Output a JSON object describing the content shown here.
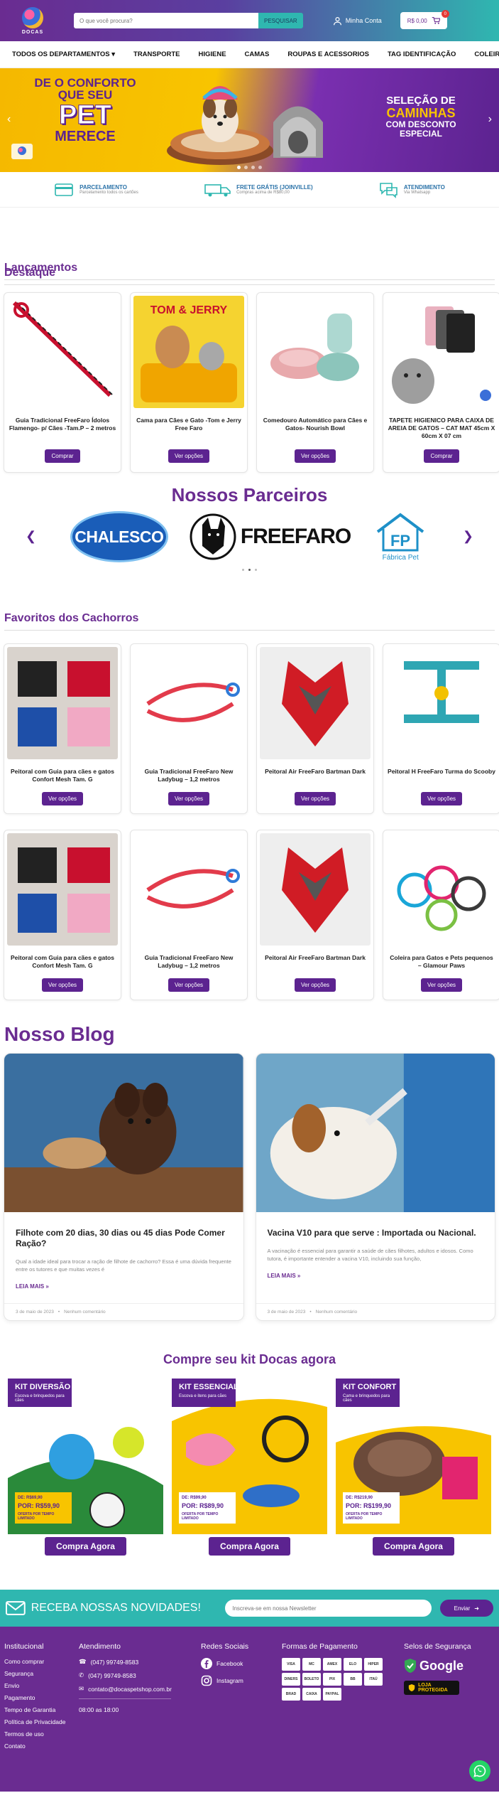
{
  "header": {
    "logo_text": "DOCAS",
    "search_placeholder": "O que você procura?",
    "search_button": "PESQUISAR",
    "account_label": "Minha Conta",
    "cart_total": "R$ 0,00",
    "cart_count": "0"
  },
  "nav": {
    "items": [
      "TODOS OS DEPARTAMENTOS",
      "TRANSPORTE",
      "HIGIENE",
      "CAMAS",
      "ROUPAS E ACESSORIOS",
      "TAG IDENTIFICAÇÃO",
      "COLEIRAS"
    ]
  },
  "hero": {
    "left_line1": "DE O CONFORTO",
    "left_line2": "QUE SEU",
    "left_line3": "PET",
    "left_line4": "MERECE",
    "right_line1": "SELEÇÃO DE",
    "right_line2": "CAMINHAS",
    "right_line3": "COM DESCONTO",
    "right_line4": "ESPECIAL",
    "prev_icon": "‹",
    "next_icon": "›"
  },
  "benefits": [
    {
      "title": "PARCELAMENTO",
      "subtitle": "Parcelamento todos os cartões",
      "icon": "credit-card-icon"
    },
    {
      "title": "FRETE GRÁTIS (JOINVILLE)",
      "subtitle": "Compras acima de R$80,00",
      "icon": "truck-icon"
    },
    {
      "title": "ATENDIMENTO",
      "subtitle": "Via Whatsapp",
      "icon": "chat-icon"
    }
  ],
  "sections": {
    "launches": "Lançamentos",
    "featured": "Destaque",
    "partners": "Nossos Parceiros",
    "dog_favorites": "Favoritos dos Cachorros",
    "blog": "Nosso Blog",
    "kits": "Compre seu kit Docas agora"
  },
  "featured_products": [
    {
      "name": "Guia Tradicional FreeFaro Ídolos Flamengo- p/ Cães -Tam.P – 2 metros",
      "button": "Comprar"
    },
    {
      "name": "Cama para Cães e Gato -Tom e Jerry Free Faro",
      "button": "Ver opções"
    },
    {
      "name": "Comedouro Automático para Cães e Gatos- Nourish Bowl",
      "button": "Ver opções"
    },
    {
      "name": "TAPETE HIGIENICO PARA CAIXA DE AREIA DE GATOS – CAT MAT 45cm X 60cm X 07 cm",
      "button": "Comprar"
    }
  ],
  "featured_extra": {
    "tom_jerry": "TOM & JERRY"
  },
  "partners": {
    "chalesco": "CHALESCO",
    "freefaro": "FREEFARO",
    "fabrica_mark": "FP",
    "fabrica": "Fábrica Pet"
  },
  "dog_favorites_row1": [
    {
      "name": "Peitoral com Guia para cães e gatos Confort Mesh Tam. G",
      "button": "Ver opções"
    },
    {
      "name": "Guia Tradicional FreeFaro New Ladybug – 1,2 metros",
      "button": "Ver opções"
    },
    {
      "name": "Peitoral Air FreeFaro Bartman Dark",
      "button": "Ver opções"
    },
    {
      "name": "Peitoral H FreeFaro Turma do Scooby",
      "button": "Ver opções"
    }
  ],
  "dog_favorites_row2": [
    {
      "name": "Peitoral com Guia para cães e gatos Confort Mesh Tam. G",
      "button": "Ver opções"
    },
    {
      "name": "Guia Tradicional FreeFaro New Ladybug – 1,2 metros",
      "button": "Ver opções"
    },
    {
      "name": "Peitoral Air FreeFaro Bartman Dark",
      "button": "Ver opções"
    },
    {
      "name": "Coleira para Gatos e Pets pequenos – Glamour Paws",
      "button": "Ver opções"
    }
  ],
  "blog": [
    {
      "title": "Filhote com 20 dias, 30 dias ou 45 dias Pode Comer Ração?",
      "excerpt": "Qual a idade ideal para trocar a ração de filhote de cachorro? Essa é uma dúvida frequente entre os tutores e que muitas vezes é",
      "more": "LEIA MAIS »",
      "date": "3 de maio de 2023",
      "comments": "Nenhum comentário"
    },
    {
      "title": "Vacina V10 para que serve : Importada ou Nacional.",
      "excerpt": "A vacinação é essencial para garantir a saúde de cães filhotes, adultos e idosos. Como tutora, é importante entender a vacina V10, incluindo sua função,",
      "more": "LEIA MAIS »",
      "date": "3 de maio de 2023",
      "comments": "Nenhum comentário"
    }
  ],
  "kits": [
    {
      "tag": "KIT DIVERSÃO",
      "tag_sub": "Escova e brinquedos para cães",
      "price_prefix": "DE: R$69,90",
      "price": "POR: R$59,90",
      "offer": "OFERTA POR TEMPO LIMITADO",
      "button": "Compra Agora"
    },
    {
      "tag": "KIT ESSENCIAL",
      "tag_sub": "Escova e itens para cães",
      "price_prefix": "DE: R$99,90",
      "price": "POR: R$89,90",
      "offer": "OFERTA POR TEMPO LIMITADO",
      "button": "Compra Agora"
    },
    {
      "tag": "KIT CONFORT",
      "tag_sub": "Cama e brinquedos para cães",
      "price_prefix": "DE: R$219,90",
      "price": "POR: R$199,90",
      "offer": "OFERTA POR TEMPO LIMITADO",
      "button": "Compra Agora"
    }
  ],
  "newsletter": {
    "text": "RECEBA NOSSAS NOVIDADES!",
    "placeholder": "Inscreva-se em nossa Newsletter",
    "button": "Enviar"
  },
  "footer": {
    "institutional_title": "Institucional",
    "institutional_links": [
      "Como comprar",
      "Segurança",
      "Envio",
      "Pagamento",
      "Tempo de Garantia",
      "Política de Privacidade",
      "Termos de uso",
      "Contato"
    ],
    "support_title": "Atendimento",
    "phone": "(047) 99749-8583",
    "whatsapp": "(047) 99749-8583",
    "email": "contato@docaspetshop.com.br",
    "hours": "08:00 as 18:00",
    "social_title": "Redes Sociais",
    "facebook": "Facebook",
    "instagram": "Instagram",
    "payment_title": "Formas de Pagamento",
    "payment_methods": [
      "VISA",
      "MC",
      "AMEX",
      "ELO",
      "HIPER",
      "DINERS",
      "BOLETO",
      "PIX",
      "BB",
      "ITAÚ",
      "BRAD",
      "CAIXA",
      "PAYPAL"
    ],
    "security_title": "Selos de Segurança",
    "google_label": "Google",
    "safe_label": "LOJA PROTEGIDA"
  }
}
